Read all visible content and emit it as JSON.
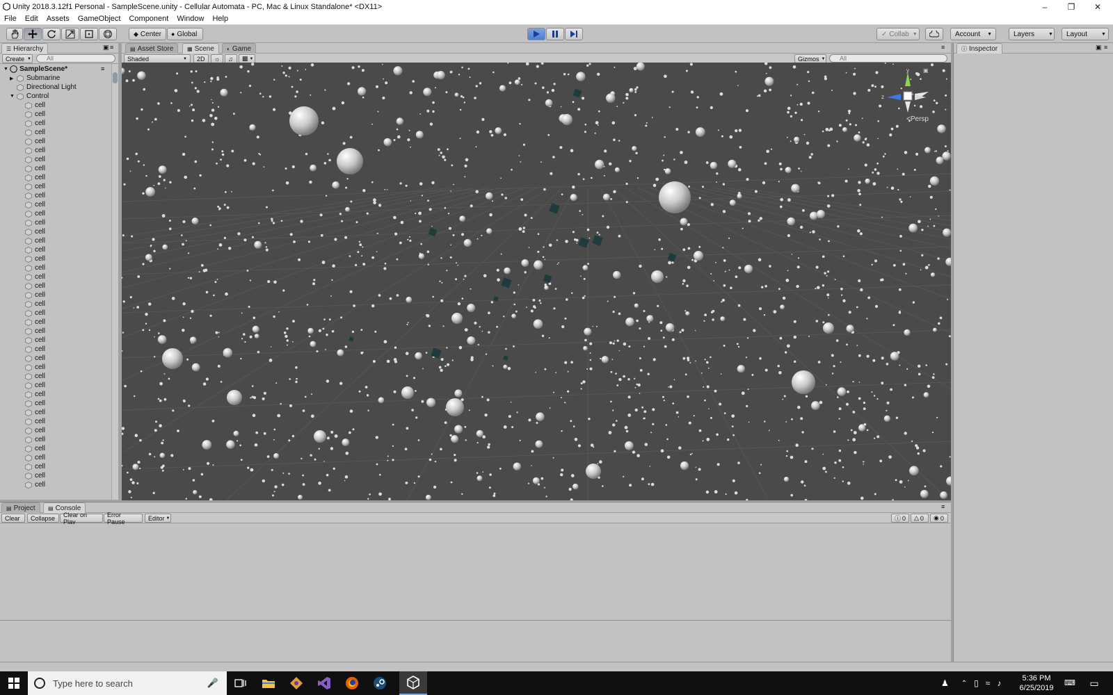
{
  "window": {
    "title": "Unity 2018.3.12f1 Personal - SampleScene.unity - Cellular Automata - PC, Mac & Linux Standalone* <DX11>",
    "controls": [
      "minimize",
      "restore",
      "close"
    ]
  },
  "menu": [
    "File",
    "Edit",
    "Assets",
    "GameObject",
    "Component",
    "Window",
    "Help"
  ],
  "toolbar": {
    "transform_tools": [
      "hand-icon",
      "move-icon",
      "rotate-icon",
      "scale-icon",
      "rect-icon",
      "transform-icon"
    ],
    "active_tool": "move-icon",
    "pivot_label": "Center",
    "space_label": "Global",
    "collab_label": "Collab",
    "account_label": "Account",
    "layers_label": "Layers",
    "layout_label": "Layout",
    "playing": true
  },
  "hierarchy": {
    "tab_label": "Hierarchy",
    "create_label": "Create",
    "search_placeholder": "All",
    "scene_name": "SampleScene*",
    "root_items": [
      "Submarine",
      "Directional Light",
      "Control"
    ],
    "child_label": "cell",
    "child_count": 43
  },
  "scene": {
    "tabs": [
      "Asset Store",
      "Scene",
      "Game"
    ],
    "active_tab": "Scene",
    "shading_mode": "Shaded",
    "mode_2d_label": "2D",
    "gizmos_label": "Gizmos",
    "search_placeholder": "All",
    "gizmo_axis_y": "y",
    "gizmo_axis_z": "z",
    "projection_label": "Persp",
    "background_color": "#4a4a4a",
    "cube_color": "#1f3b3d"
  },
  "inspector": {
    "tab_label": "Inspector"
  },
  "console": {
    "tabs": [
      "Project",
      "Console"
    ],
    "active_tab": "Console",
    "buttons": [
      "Clear",
      "Collapse",
      "Clear on Play",
      "Error Pause",
      "Editor"
    ],
    "log_count": "0",
    "warning_count": "0",
    "error_count": "0"
  },
  "taskbar": {
    "search_placeholder": "Type here to search",
    "time": "5:36 PM",
    "date": "6/25/2019",
    "app_icons": [
      "task-view-icon",
      "file-explorer-icon",
      "git-icon",
      "visual-studio-icon",
      "firefox-icon",
      "steam-icon",
      "unity-icon"
    ]
  }
}
